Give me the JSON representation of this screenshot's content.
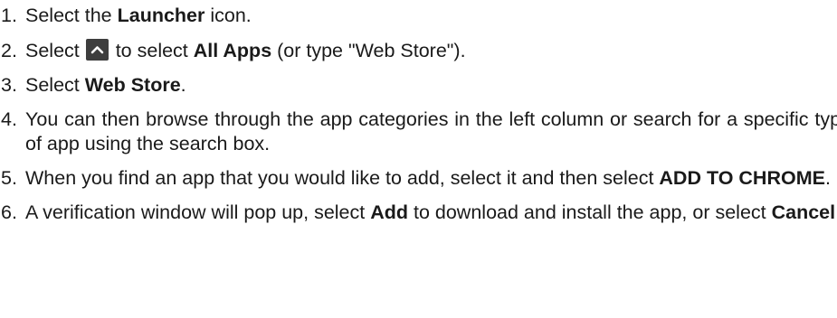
{
  "steps": [
    {
      "num": "1.",
      "before": "Select ",
      "bold": "Launcher",
      "after": " icon.",
      "lead": "the "
    },
    {
      "num": "2.",
      "pre": "Select ",
      "icon": "chevron-up-icon",
      "mid": " to select ",
      "bold": "All Apps",
      "after": " (or type \"Web Store\")."
    },
    {
      "num": "3.",
      "pre": "Select ",
      "bold": "Web Store",
      "after": "."
    },
    {
      "num": "4.",
      "text": "You can then browse through the app categories in the left column or search for a specific type of app using the search box."
    },
    {
      "num": "5.",
      "pre": "When you find an app that you would like to add, select it and then select ",
      "bold": "ADD TO CHROME",
      "after": "."
    },
    {
      "num": "6.",
      "pre": "A verification window will pop up, select ",
      "bold1": "Add",
      "mid": " to download and install the app, or select ",
      "bold2": "Cancel",
      "after": "."
    }
  ],
  "colors": {
    "text": "#1a1a1a",
    "icon_bg": "#3d3d3d",
    "icon_fg": "#ffffff"
  }
}
